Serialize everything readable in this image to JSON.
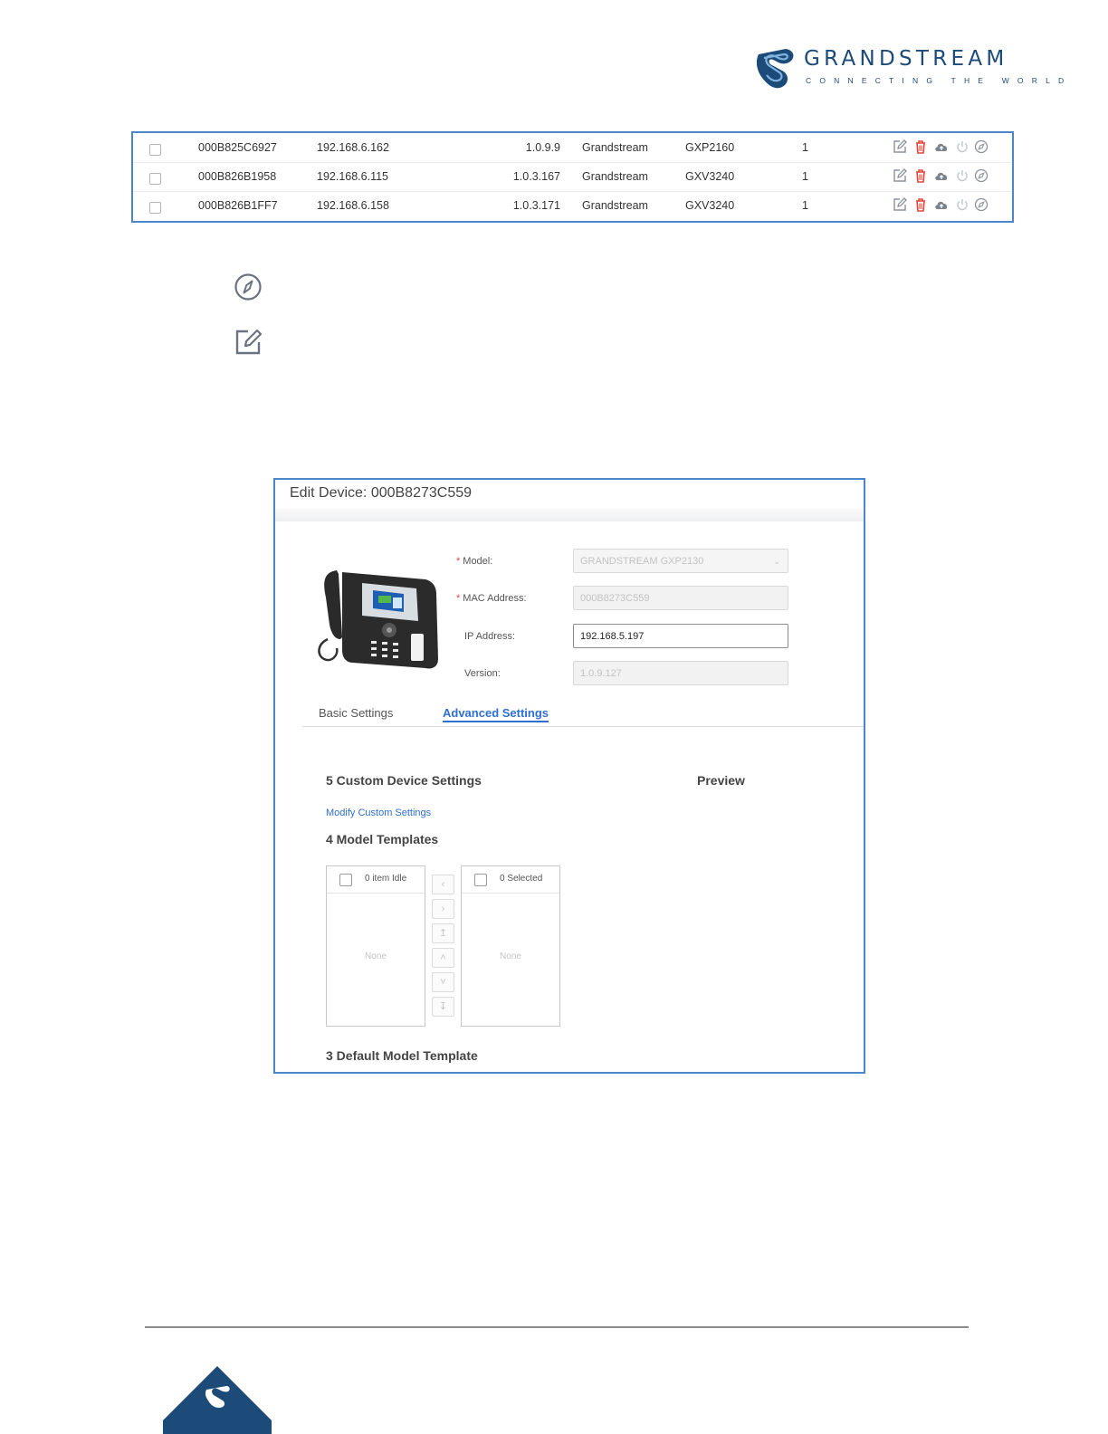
{
  "brand": {
    "name": "GRANDSTREAM",
    "tagline": "CONNECTING THE WORLD",
    "color": "#1c4a79"
  },
  "device_table": {
    "rows": [
      {
        "mac": "000B825C6927",
        "ip": "192.168.6.162",
        "version": "1.0.9.9",
        "vendor": "Grandstream",
        "model": "GXP2160",
        "accounts": "1"
      },
      {
        "mac": "000B826B1958",
        "ip": "192.168.6.115",
        "version": "1.0.3.167",
        "vendor": "Grandstream",
        "model": "GXV3240",
        "accounts": "1"
      },
      {
        "mac": "000B826B1FF7",
        "ip": "192.168.6.158",
        "version": "1.0.3.171",
        "vendor": "Grandstream",
        "model": "GXV3240",
        "accounts": "1"
      }
    ],
    "row_actions": [
      "edit-icon",
      "delete-icon",
      "cloud-upload-icon",
      "power-icon",
      "compass-icon"
    ]
  },
  "standalone_icons": [
    "compass-icon",
    "edit-icon"
  ],
  "edit_dialog": {
    "title": "Edit Device: 000B8273C559",
    "fields": {
      "model": {
        "label": "Model:",
        "value": "GRANDSTREAM GXP2130",
        "required": true
      },
      "mac": {
        "label": "MAC Address:",
        "value": "000B8273C559",
        "required": true
      },
      "ip": {
        "label": "IP Address:",
        "value": "192.168.5.197"
      },
      "version": {
        "label": "Version:",
        "value": "1.0.9.127"
      }
    },
    "tabs": {
      "basic": "Basic Settings",
      "advanced": "Advanced Settings",
      "active": "advanced"
    },
    "custom_settings_heading": "5 Custom Device Settings",
    "preview_heading": "Preview",
    "modify_link": "Modify Custom Settings",
    "model_templates_heading": "4 Model Templates",
    "transfer": {
      "left_header": "0 item Idle",
      "right_header": "0 Selected",
      "empty_text": "None",
      "left_empty": "None",
      "right_empty": "None"
    },
    "default_template_heading": "3 Default Model Template"
  },
  "colors": {
    "accent": "#2f6fd1",
    "frame": "#4a86c8",
    "delete": "#e0473c"
  }
}
